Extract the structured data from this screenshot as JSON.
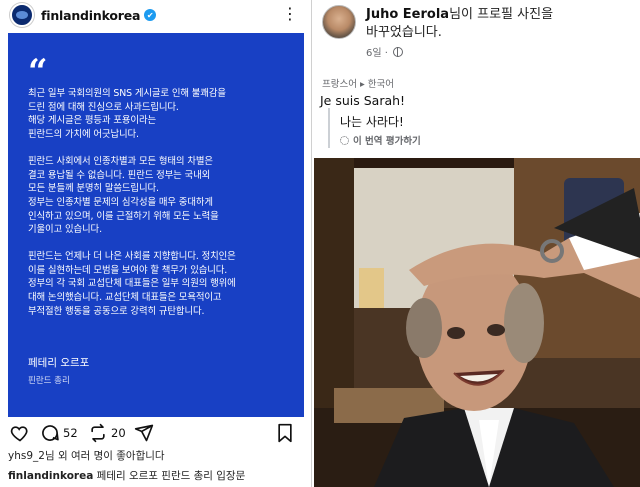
{
  "instagram": {
    "username": "finlandinkorea",
    "verified_mark": "✔",
    "more_icon": "⋮",
    "card": {
      "quote_mark": "“",
      "paragraphs": [
        [
          "최근 일부 국회의원의 SNS 게시글로 인해 불쾌감을",
          "드린 점에 대해 진심으로 사과드립니다.",
          "해당 게시글은 평등과 포용이라는",
          "핀란드의 가치에 어긋납니다."
        ],
        [
          "핀란드 사회에서 인종차별과 모든 형태의 차별은",
          "결코 용납될 수 없습니다. 핀란드 정부는 국내외",
          "모든 분들께 분명히 말씀드립니다.",
          "정부는 인종차별 문제의 심각성을 매우 중대하게",
          "인식하고 있으며, 이를 근절하기 위해 모든 노력을",
          "기울이고 있습니다."
        ],
        [
          "핀란드는 언제나 더 나은 사회를 지향합니다. 정치인은",
          "이를 실현하는데 모범을 보여야 할 책무가 있습니다.",
          "정부의 각 국회 교섭단체 대표들은 일부 의원의 행위에",
          "대해 논의했습니다. 교섭단체 대표들은 모욕적이고",
          "부적절한 행동을 공동으로 강력히 규탄합니다."
        ]
      ],
      "signature": "페테리 오르포",
      "signature_title": "핀란드 총리"
    },
    "comments_count": "52",
    "reposts_count": "20",
    "likes_text": "yhs9_2님 외 여러 명이 좋아합니다",
    "caption_user": "finlandinkorea",
    "caption_text": "페테리 오르포 핀란드 총리 입장문",
    "colors": {
      "card_bg": "#1840c4",
      "verified": "#1d9bf0"
    }
  },
  "facebook": {
    "author": "Juho Eerola",
    "title_suffix_1": "님이 프로필 사진을",
    "title_suffix_2": "바꾸었습니다.",
    "time": "6일 ·",
    "language_line": "프랑스어 ▸ 한국어",
    "original_text": "Je suis Sarah!",
    "translated_text": "나는 사라다!",
    "rate_translation": "이 번역 평가하기"
  }
}
